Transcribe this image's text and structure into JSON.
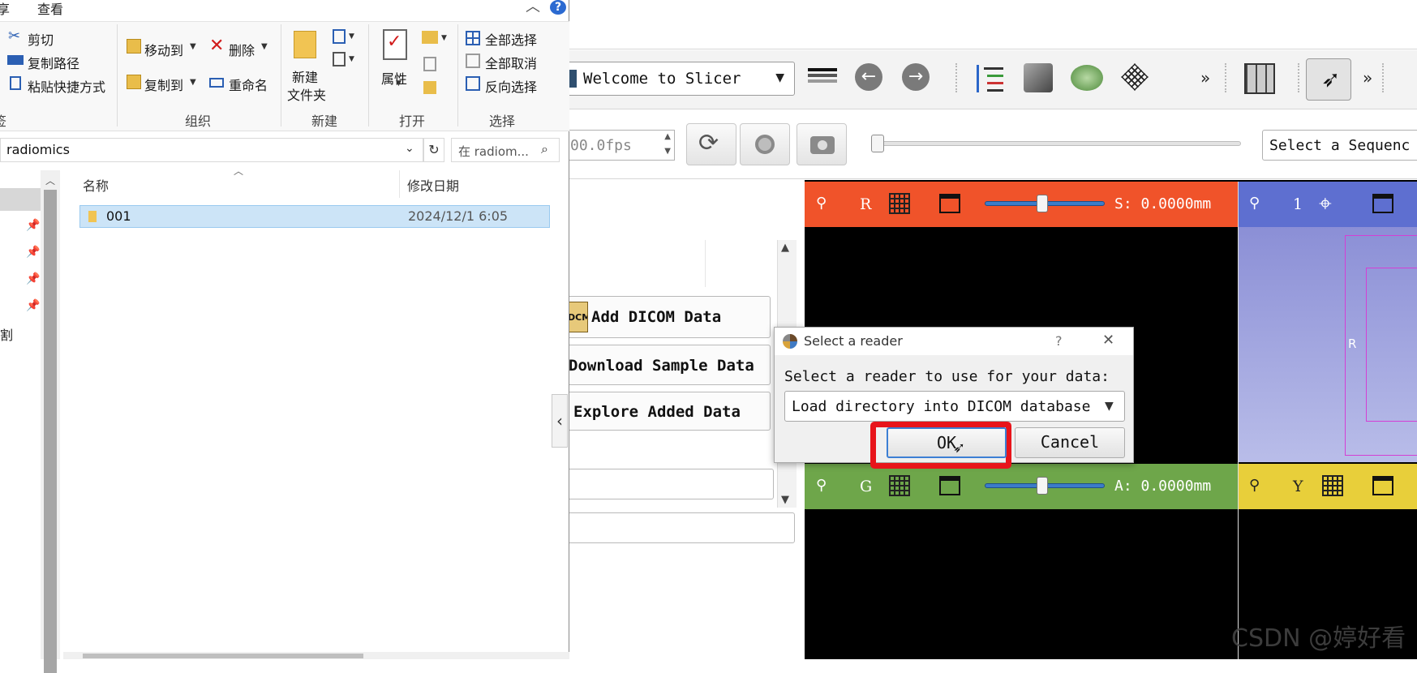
{
  "slicer": {
    "module_selector": "Welcome to Slicer",
    "fps_value": "00.0fps",
    "sequence_selector": "Select a Sequenc",
    "welcome_buttons": {
      "add_dicom": "Add DICOM Data",
      "download_sample": "Download Sample Data",
      "explore_added": "Explore Added Data"
    },
    "dicom_badge": "DCM",
    "red_view": {
      "letter": "R",
      "offset": "S: 0.0000mm",
      "color": "#f0532a"
    },
    "blue_view": {
      "letter": "1",
      "color": "#5e6fd0"
    },
    "green_view": {
      "letter": "G",
      "offset": "A: 0.0000mm",
      "color": "#6ea64a"
    },
    "yellow_view": {
      "letter": "Y",
      "color": "#e8cf3a"
    },
    "three_d_label": "R",
    "collapse_arrow": "‹"
  },
  "explorer": {
    "tabs": {
      "share_fragment": "享",
      "view": "查看"
    },
    "ribbon": {
      "cut": "剪切",
      "copy_path": "复制路径",
      "paste_shortcut": "粘贴快捷方式",
      "move_to": "移动到",
      "copy_to": "复制到",
      "delete": "删除",
      "rename": "重命名",
      "new_folder_line1": "新建",
      "new_folder_line2": "文件夹",
      "properties": "属性",
      "select_all": "全部选择",
      "select_none": "全部取消",
      "invert_selection": "反向选择",
      "groups": {
        "organize": "组织",
        "new": "新建",
        "open": "打开",
        "select": "选择"
      }
    },
    "address": "radiomics",
    "search_placeholder": "在 radiom...",
    "columns": {
      "name": "名称",
      "modified": "修改日期"
    },
    "files": [
      {
        "name": "001",
        "modified": "2024/12/1 6:05"
      }
    ],
    "nav_fragment": "割",
    "left_fragment": "签"
  },
  "dialog": {
    "title": "Select a reader",
    "help": "?",
    "close": "✕",
    "prompt": "Select a reader to use for your data:",
    "reader_option": "Load directory into DICOM database",
    "ok": "OK",
    "cancel": "Cancel",
    "highlight_color": "#e8141b"
  },
  "watermark": "CSDN @婷好看"
}
